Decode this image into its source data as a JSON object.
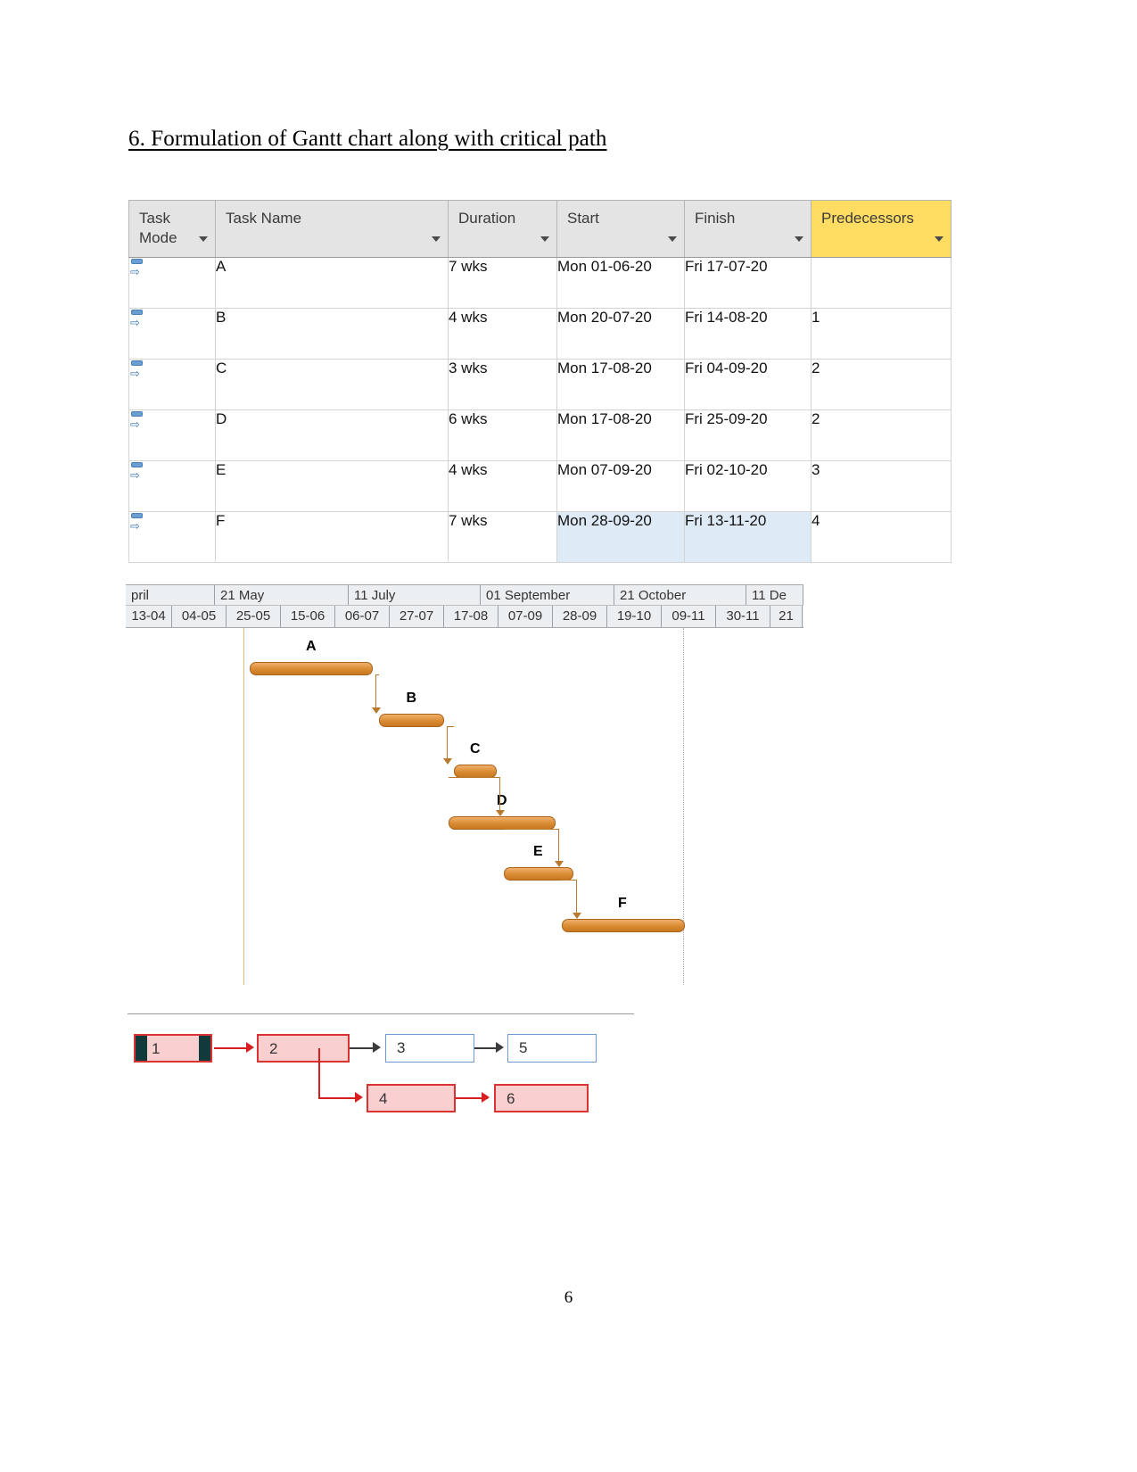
{
  "document": {
    "heading": "6. Formulation of Gantt chart along with critical path",
    "page_number": "6"
  },
  "table": {
    "columns": [
      {
        "label": "Task Mode",
        "highlight": false
      },
      {
        "label": "Task Name",
        "highlight": false
      },
      {
        "label": "Duration",
        "highlight": false
      },
      {
        "label": "Start",
        "highlight": false
      },
      {
        "label": "Finish",
        "highlight": false
      },
      {
        "label": "Predecessors",
        "highlight": true
      }
    ],
    "filter_icon": "chevron-down-icon",
    "task_mode_icon": "auto-scheduled-icon",
    "highlight_color": "#ffdd63",
    "selection_color": "#dfeaf7",
    "rows": [
      {
        "task_mode": "",
        "name": "A",
        "duration": "7 wks",
        "start": "Mon 01-06-20",
        "finish": "Fri 17-07-20",
        "predecessors": "",
        "selected": false
      },
      {
        "task_mode": "",
        "name": "B",
        "duration": "4 wks",
        "start": "Mon 20-07-20",
        "finish": "Fri 14-08-20",
        "predecessors": "1",
        "selected": false
      },
      {
        "task_mode": "",
        "name": "C",
        "duration": "3 wks",
        "start": "Mon 17-08-20",
        "finish": "Fri 04-09-20",
        "predecessors": "2",
        "selected": false
      },
      {
        "task_mode": "",
        "name": "D",
        "duration": "6 wks",
        "start": "Mon 17-08-20",
        "finish": "Fri 25-09-20",
        "predecessors": "2",
        "selected": false
      },
      {
        "task_mode": "",
        "name": "E",
        "duration": "4 wks",
        "start": "Mon 07-09-20",
        "finish": "Fri 02-10-20",
        "predecessors": "3",
        "selected": false
      },
      {
        "task_mode": "",
        "name": "F",
        "duration": "7 wks",
        "start": "Mon 28-09-20",
        "finish": "Fri 13-11-20",
        "predecessors": "4",
        "selected": true
      }
    ]
  },
  "chart_data": {
    "type": "bar",
    "title": "Gantt chart",
    "xlabel": "",
    "ylabel": "",
    "orientation": "horizontal",
    "timeline_months": [
      "pril",
      "21 May",
      "11 July",
      "01 September",
      "21 October",
      "11 De"
    ],
    "timeline_days": [
      "13-04",
      "04-05",
      "25-05",
      "15-06",
      "06-07",
      "27-07",
      "17-08",
      "07-09",
      "28-09",
      "19-10",
      "09-11",
      "30-11",
      "21"
    ],
    "bar_color": "#d88b33",
    "link_color": "#b87a2e",
    "categories": [
      "A",
      "B",
      "C",
      "D",
      "E",
      "F"
    ],
    "bars": [
      {
        "label": "A",
        "start": "Mon 01-06-20",
        "finish": "Fri 17-07-20",
        "duration_weeks": 7
      },
      {
        "label": "B",
        "start": "Mon 20-07-20",
        "finish": "Fri 14-08-20",
        "duration_weeks": 4
      },
      {
        "label": "C",
        "start": "Mon 17-08-20",
        "finish": "Fri 04-09-20",
        "duration_weeks": 3
      },
      {
        "label": "D",
        "start": "Mon 17-08-20",
        "finish": "Fri 25-09-20",
        "duration_weeks": 6
      },
      {
        "label": "E",
        "start": "Mon 07-09-20",
        "finish": "Fri 02-10-20",
        "duration_weeks": 4
      },
      {
        "label": "F",
        "start": "Mon 28-09-20",
        "finish": "Fri 13-11-20",
        "duration_weeks": 7
      }
    ],
    "values": [
      7,
      4,
      3,
      6,
      4,
      7
    ]
  },
  "network": {
    "critical_color": "#d93333",
    "critical_fill": "#f9cfcf",
    "normal_border": "#6e9bd2",
    "nodes": [
      {
        "id": "1",
        "label": "1",
        "style": "milestone"
      },
      {
        "id": "2",
        "label": "2",
        "style": "critical"
      },
      {
        "id": "3",
        "label": "3",
        "style": "normal"
      },
      {
        "id": "5",
        "label": "5",
        "style": "normal"
      },
      {
        "id": "4",
        "label": "4",
        "style": "critical"
      },
      {
        "id": "6",
        "label": "6",
        "style": "critical"
      }
    ],
    "links": [
      {
        "from": "1",
        "to": "2",
        "critical": true
      },
      {
        "from": "2",
        "to": "3",
        "critical": false
      },
      {
        "from": "3",
        "to": "5",
        "critical": false
      },
      {
        "from": "2",
        "to": "4",
        "critical": true
      },
      {
        "from": "4",
        "to": "6",
        "critical": true
      }
    ]
  }
}
